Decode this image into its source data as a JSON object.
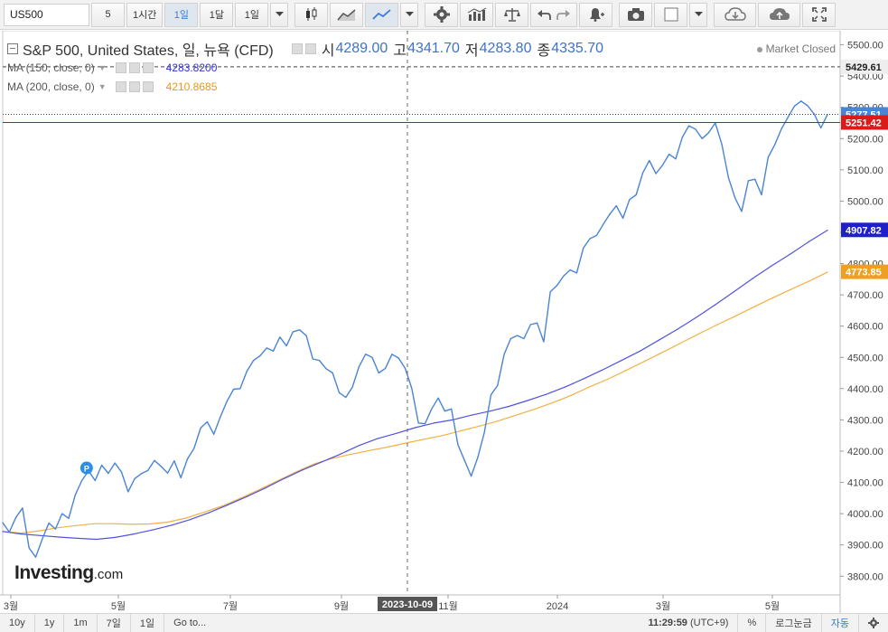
{
  "toolbar": {
    "symbol": "US500",
    "interval_value": "5",
    "btn_1h": "1시간",
    "btn_1d": "1일",
    "btn_1mo": "1달",
    "btn_1d_select": "1일"
  },
  "legend": {
    "title": "S&P 500, United States, 일, 뉴욕 (CFD)",
    "open_label": "시",
    "open": "4289.00",
    "high_label": "고",
    "high": "4341.70",
    "low_label": "저",
    "low": "4283.80",
    "close_label": "종",
    "close": "4335.70",
    "ma150_label": "MA (150, close, 0)",
    "ma150_value": "4283.8200",
    "ma200_label": "MA (200, close, 0)",
    "ma200_value": "4210.8685",
    "market_status": "Market Closed"
  },
  "logo": {
    "name": "Investing",
    "suffix": ".com"
  },
  "colors": {
    "price_line": "#4a84d4",
    "ma150": "#5252dd",
    "ma200": "#f2b043",
    "high_line": "#555555",
    "red_line": "#cc1111"
  },
  "markers": {
    "p_label": "P"
  },
  "bottombar": {
    "ranges": [
      "10y",
      "1y",
      "1m",
      "7일",
      "1일"
    ],
    "goto": "Go to...",
    "time": "11:29:59",
    "tz": "(UTC+9)",
    "percent": "%",
    "log": "로그눈금",
    "auto": "자동"
  },
  "chart_data": {
    "type": "line",
    "x_ticks": [
      "3월",
      "5월",
      "7월",
      "9월",
      "11월",
      "2024",
      "3월",
      "5월"
    ],
    "crosshair_date": "2023-10-09",
    "y_ticks": [
      3800,
      3900,
      4000,
      4100,
      4200,
      4300,
      4400,
      4500,
      4600,
      4700,
      4800,
      4900,
      5000,
      5100,
      5200,
      5300,
      5400,
      5500
    ],
    "ylim": [
      3740,
      5545
    ],
    "tick_suffix": ".00",
    "price_labels": [
      {
        "value": 5429.61,
        "label": "5429.61",
        "color": "#444444",
        "bg": "#eeeeee",
        "text": "#222222"
      },
      {
        "value": 5277.51,
        "label": "5277.51",
        "color": "#4a84d4",
        "bg": "#4a84d4",
        "text": "#ffffff"
      },
      {
        "value": 5251.42,
        "label": "5251.42",
        "color": "#cc1111",
        "bg": "#dd1a1a",
        "text": "#ffffff"
      },
      {
        "value": 4907.82,
        "label": "4907.82",
        "color": "#2020c8",
        "bg": "#2020c8",
        "text": "#ffffff"
      },
      {
        "value": 4773.85,
        "label": "4773.85",
        "color": "#f0a020",
        "bg": "#f0a020",
        "text": "#ffffff"
      }
    ],
    "series": [
      {
        "name": "S&P 500",
        "values": [
          3971,
          3941,
          3988,
          4018,
          3890,
          3861,
          3919,
          3970,
          3951,
          4000,
          3985,
          4060,
          4106,
          4137,
          4106,
          4155,
          4129,
          4162,
          4133,
          4070,
          4112,
          4128,
          4138,
          4170,
          4151,
          4130,
          4169,
          4115,
          4175,
          4209,
          4274,
          4294,
          4254,
          4310,
          4360,
          4398,
          4400,
          4455,
          4490,
          4505,
          4530,
          4520,
          4565,
          4537,
          4582,
          4588,
          4570,
          4495,
          4490,
          4464,
          4450,
          4387,
          4372,
          4405,
          4470,
          4510,
          4500,
          4450,
          4465,
          4510,
          4498,
          4465,
          4401,
          4290,
          4288,
          4335,
          4370,
          4328,
          4335,
          4220,
          4170,
          4120,
          4180,
          4260,
          4380,
          4410,
          4510,
          4560,
          4570,
          4560,
          4605,
          4610,
          4550,
          4710,
          4730,
          4760,
          4780,
          4770,
          4850,
          4880,
          4890,
          4925,
          4958,
          4985,
          4945,
          5005,
          5020,
          5090,
          5130,
          5088,
          5115,
          5150,
          5135,
          5204,
          5241,
          5230,
          5200,
          5219,
          5250,
          5181,
          5075,
          5010,
          4967,
          5065,
          5070,
          5020,
          5140,
          5180,
          5230,
          5268,
          5304,
          5320,
          5305,
          5278,
          5234,
          5277
        ]
      },
      {
        "name": "MA 150",
        "values": [
          3943,
          3935,
          3930,
          3925,
          3921,
          3918,
          3924,
          3935,
          3948,
          3963,
          3981,
          4003,
          4028,
          4054,
          4082,
          4112,
          4140,
          4165,
          4190,
          4218,
          4240,
          4257,
          4275,
          4290,
          4300,
          4315,
          4328,
          4343,
          4362,
          4382,
          4405,
          4432,
          4460,
          4490,
          4520,
          4555,
          4590,
          4628,
          4668,
          4710,
          4752,
          4792,
          4830,
          4870,
          4907
        ]
      },
      {
        "name": "MA 200",
        "values": [
          3943,
          3938,
          3945,
          3955,
          3962,
          3968,
          3968,
          3966,
          3967,
          3973,
          3986,
          4005,
          4025,
          4050,
          4077,
          4105,
          4133,
          4159,
          4177,
          4190,
          4202,
          4213,
          4226,
          4238,
          4250,
          4265,
          4280,
          4296,
          4315,
          4334,
          4355,
          4378,
          4405,
          4430,
          4458,
          4487,
          4516,
          4546,
          4576,
          4605,
          4633,
          4662,
          4690,
          4717,
          4744,
          4773
        ]
      }
    ]
  }
}
